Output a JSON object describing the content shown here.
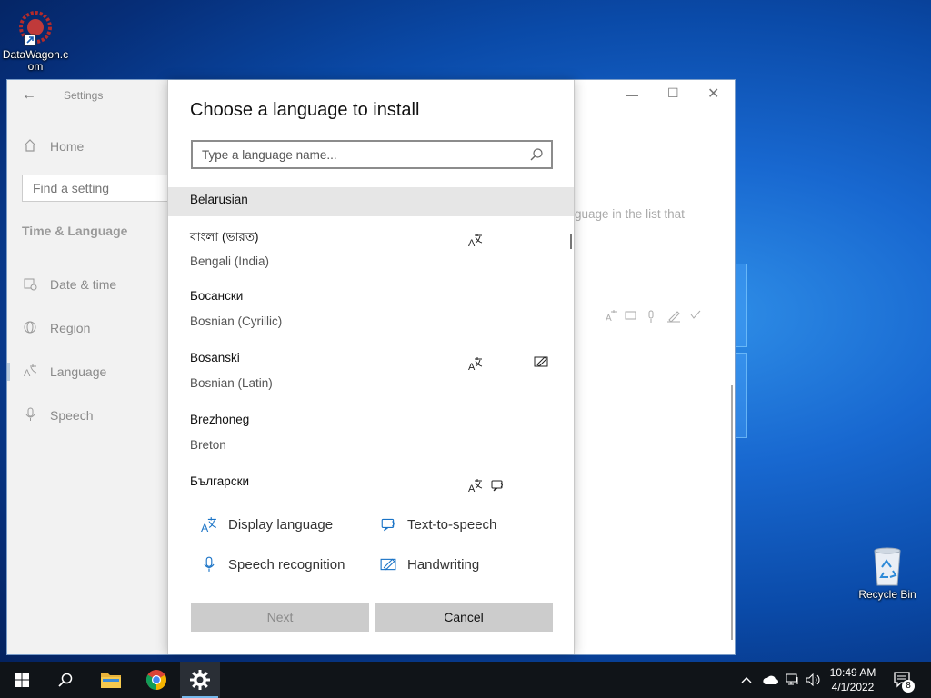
{
  "desktop": {
    "icons": [
      {
        "label": "DataWagon.com",
        "icon": "datawagon-shortcut-icon"
      },
      {
        "label": "Recycle Bin",
        "icon": "recycle-bin-icon"
      }
    ]
  },
  "settings": {
    "app_title": "Settings",
    "nav": {
      "home": "Home",
      "find_placeholder": "Find a setting",
      "section": "Time & Language",
      "items": [
        {
          "label": "Date & time",
          "icon": "calendar-clock-icon"
        },
        {
          "label": "Region",
          "icon": "globe-icon"
        },
        {
          "label": "Language",
          "icon": "language-icon"
        },
        {
          "label": "Speech",
          "icon": "microphone-icon"
        }
      ]
    },
    "background_text": "guage in the list that"
  },
  "dialog": {
    "title": "Choose a language to install",
    "search_placeholder": "Type a language name...",
    "languages": [
      {
        "native": "Belarusian",
        "english": "",
        "highlighted": true,
        "features": []
      },
      {
        "native": "বাংলা (ভারত)",
        "english": "Bengali (India)",
        "features": [
          "display-language"
        ]
      },
      {
        "native": "Босански",
        "english": "Bosnian (Cyrillic)",
        "features": []
      },
      {
        "native": "Bosanski",
        "english": "Bosnian (Latin)",
        "features": [
          "display-language",
          "handwriting"
        ]
      },
      {
        "native": "Brezhoneg",
        "english": "Breton",
        "features": []
      },
      {
        "native": "Български",
        "english": "",
        "features": [
          "display-language",
          "text-to-speech"
        ]
      }
    ],
    "legend": {
      "display_language": "Display language",
      "text_to_speech": "Text-to-speech",
      "speech_recognition": "Speech recognition",
      "handwriting": "Handwriting"
    },
    "buttons": {
      "next": "Next",
      "cancel": "Cancel"
    }
  },
  "taskbar": {
    "apps": [
      "start-icon",
      "search-icon",
      "file-explorer-icon",
      "chrome-icon",
      "settings-gear-icon"
    ],
    "clock": {
      "time": "10:49 AM",
      "date": "4/1/2022"
    },
    "notifications_count": "8"
  },
  "colors": {
    "accent": "#0078d7",
    "taskbar": "#101418",
    "button": "#cccccc"
  }
}
